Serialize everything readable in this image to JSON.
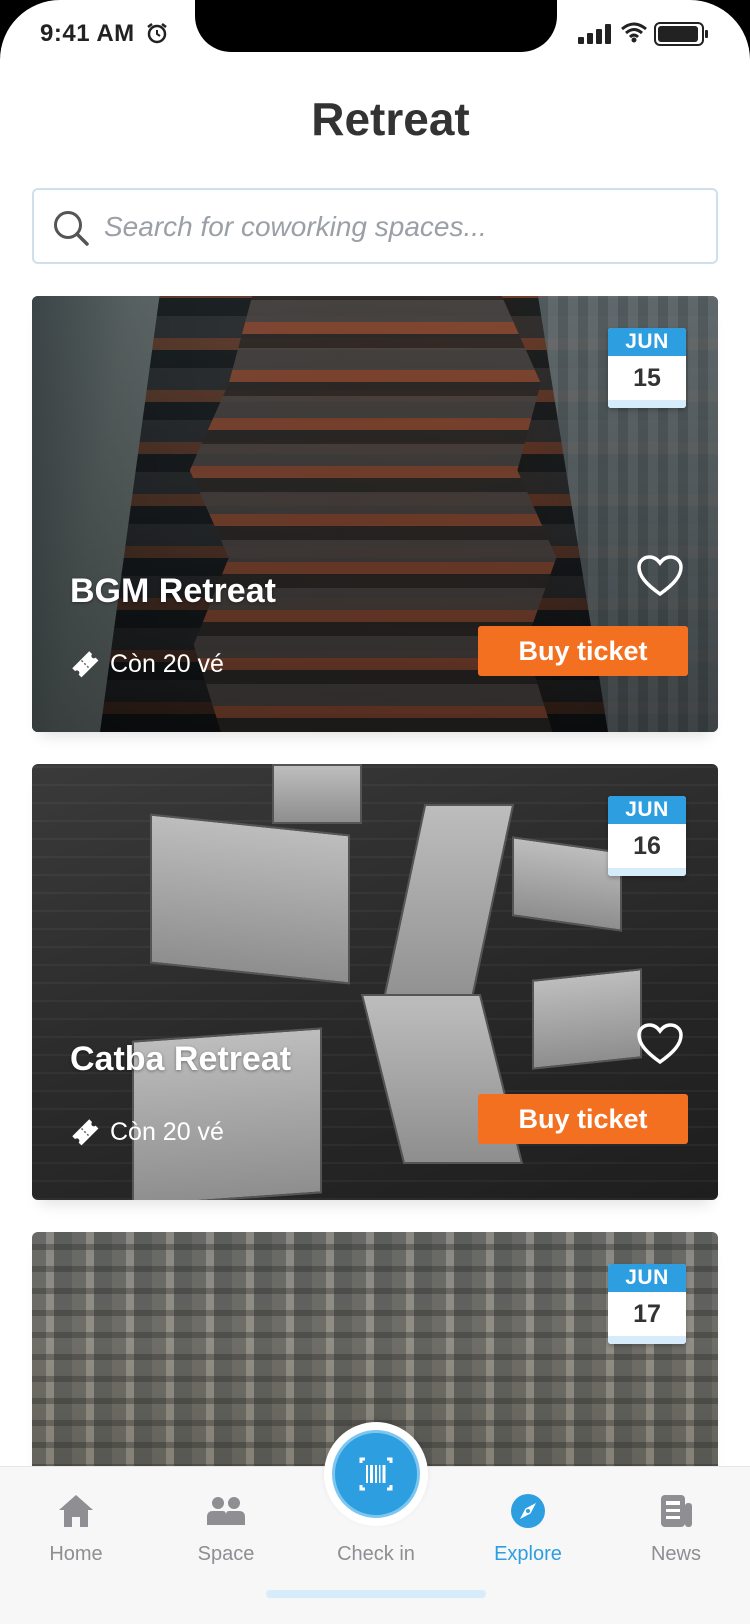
{
  "status_bar": {
    "time": "9:41 AM"
  },
  "page": {
    "title": "Retreat"
  },
  "search": {
    "placeholder": "Search for coworking spaces..."
  },
  "events": [
    {
      "title": "BGM Retreat",
      "month": "JUN",
      "day": "15",
      "tickets": "Còn 20 vé",
      "cta": "Buy ticket"
    },
    {
      "title": "Catba Retreat",
      "month": "JUN",
      "day": "16",
      "tickets": "Còn 20 vé",
      "cta": "Buy ticket"
    },
    {
      "month": "JUN",
      "day": "17"
    }
  ],
  "tabbar": {
    "tabs": [
      {
        "label": "Home",
        "icon": "home-icon"
      },
      {
        "label": "Space",
        "icon": "people-icon"
      },
      {
        "label": "Check in",
        "icon": "barcode-scan-icon"
      },
      {
        "label": "Explore",
        "icon": "compass-icon",
        "active": true
      },
      {
        "label": "News",
        "icon": "news-icon"
      }
    ]
  },
  "colors": {
    "accent": "#2d9fe0",
    "cta": "#f37021",
    "title": "#333333",
    "inactive_tab": "#8e8e93"
  }
}
